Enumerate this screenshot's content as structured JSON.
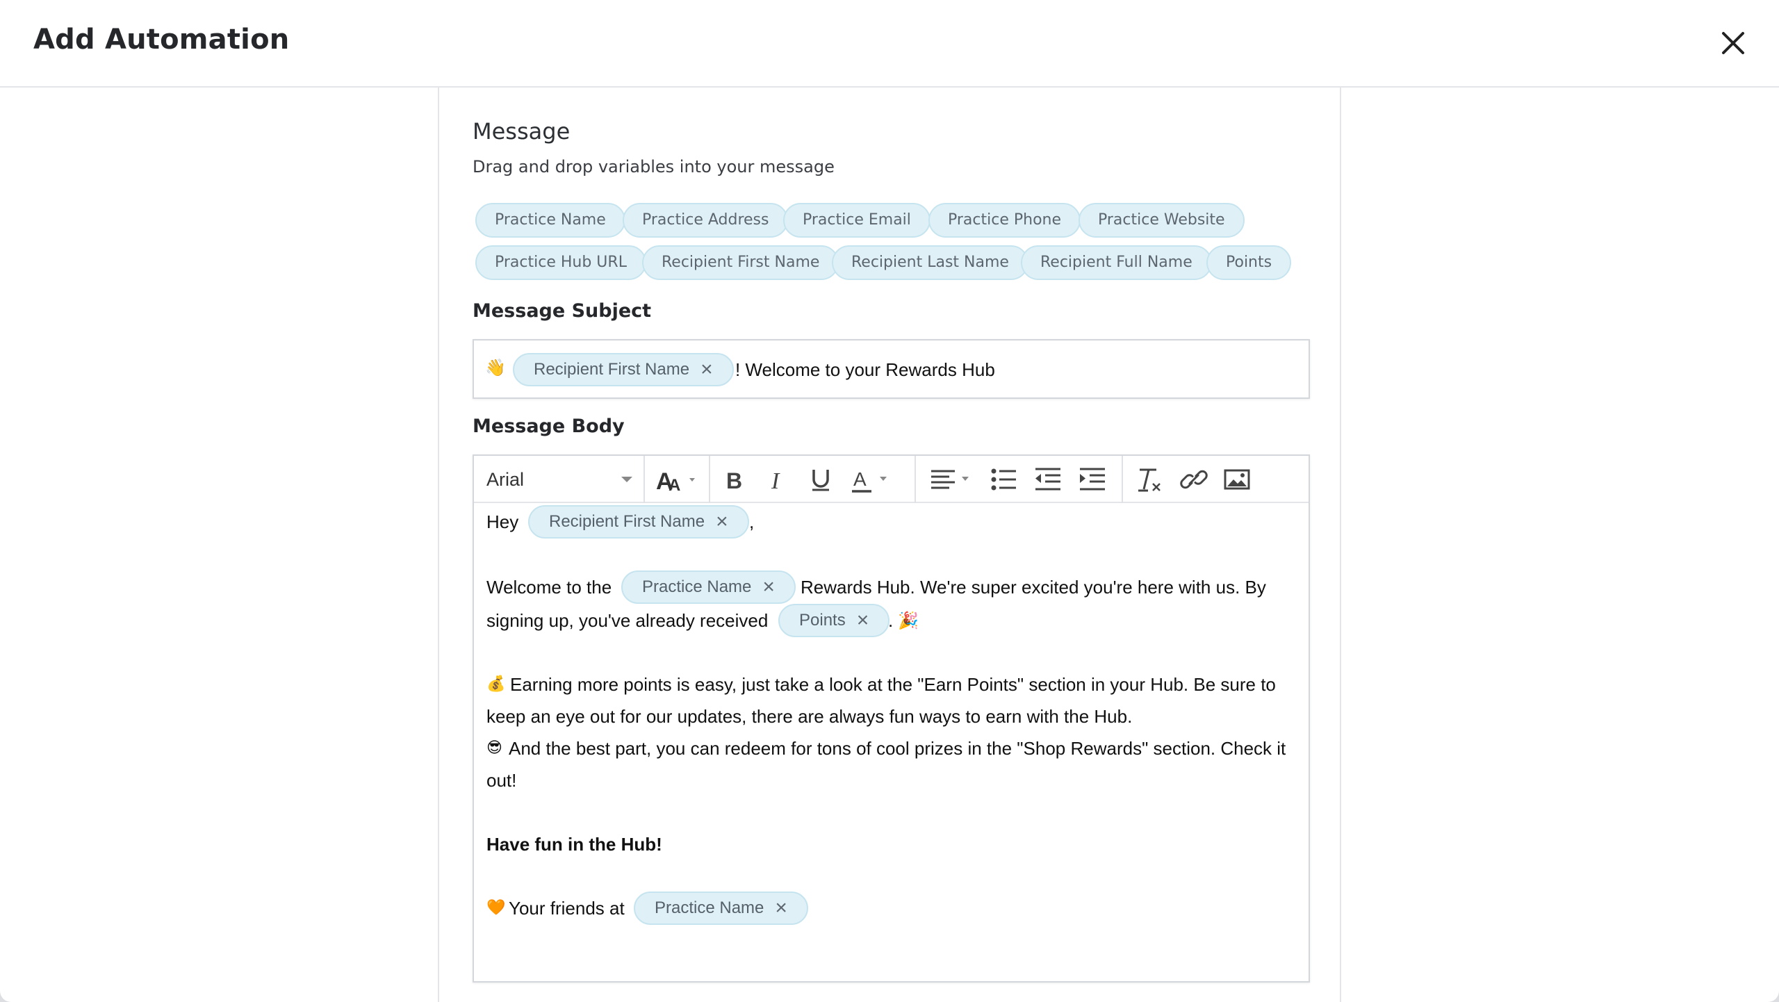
{
  "header": {
    "title": "Add Automation",
    "close_icon": "close-icon"
  },
  "message": {
    "title": "Message",
    "subtitle": "Drag and drop variables into your message",
    "variables": [
      "Practice Name",
      "Practice Address",
      "Practice Email",
      "Practice Phone",
      "Practice Website",
      "Practice Hub URL",
      "Recipient First Name",
      "Recipient Last Name",
      "Recipient Full Name",
      "Points"
    ]
  },
  "subject": {
    "label": "Message Subject",
    "emoji": "👋",
    "chip": "Recipient First Name",
    "text": "! Welcome to your Rewards Hub"
  },
  "body": {
    "label": "Message Body",
    "toolbar": {
      "font": "Arial",
      "icons": [
        "font-size-icon",
        "bold-icon",
        "italic-icon",
        "underline-icon",
        "text-color-icon",
        "align-left-icon",
        "bullet-list-icon",
        "outdent-icon",
        "indent-icon",
        "clear-format-icon",
        "link-icon",
        "image-icon"
      ]
    },
    "line1_pre": "Hey",
    "line1_chip": "Recipient First Name",
    "line1_post": ",",
    "p2_pre": "Welcome to the",
    "p2_chip": "Practice Name",
    "p2_mid": "Rewards Hub. We're super excited you're here with us. By",
    "p2_line2_pre": "signing up, you've already received",
    "p2_chip2": "Points",
    "p2_post": ".",
    "p2_emoji": "🎉",
    "p3_emoji": "💰",
    "p3_line1": "Earning more points is easy, just take a look at the \"Earn Points\" section in your Hub. Be sure to",
    "p3_line2": "keep an eye out for our updates, there are always fun ways to earn with the Hub.",
    "p4_emoji": "😎",
    "p4_line1": "And the best part, you can redeem for tons of cool prizes in the \"Shop Rewards\" section. Check it",
    "p4_line2": "out!",
    "p5": "Have fun in the Hub!",
    "p6_emoji": "🧡",
    "p6_pre": "Your friends at",
    "p6_chip": "Practice Name"
  }
}
